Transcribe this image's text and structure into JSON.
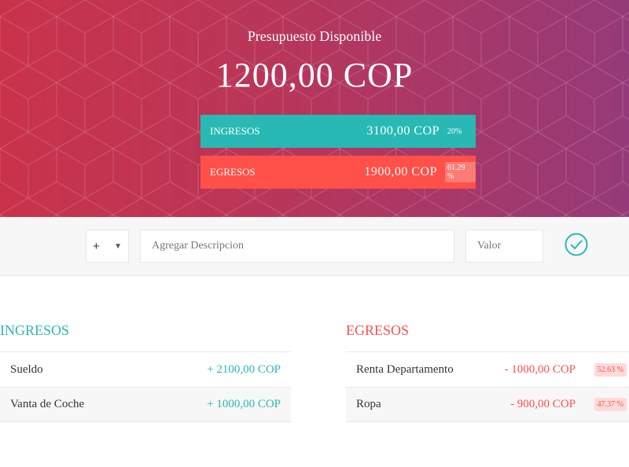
{
  "header": {
    "title": "Presupuesto Disponible",
    "budget": "1200,00 COP"
  },
  "summary": {
    "income": {
      "label": "Ingresos",
      "amount": "3100,00 COP",
      "percent": "20%"
    },
    "expense": {
      "label": "Egresos",
      "amount": "1900,00 COP",
      "percent": "61.29 %"
    }
  },
  "add_form": {
    "type_value": "+",
    "description_placeholder": "Agregar Descripcion",
    "value_placeholder": "Valor"
  },
  "income_list": {
    "title": "Ingresos",
    "items": [
      {
        "description": "Sueldo",
        "value": "+ 2100,00 COP"
      },
      {
        "description": "Vanta de Coche",
        "value": "+ 1000,00 COP"
      }
    ]
  },
  "expense_list": {
    "title": "Egresos",
    "items": [
      {
        "description": "Renta Departamento",
        "value": "- 1000,00 COP",
        "percent": "52.63 %"
      },
      {
        "description": "Ropa",
        "value": "- 900,00 COP",
        "percent": "47.37 %"
      }
    ]
  },
  "colors": {
    "income": "#28b9b5",
    "expense": "#ff5049",
    "header_gradient_start": "#c9334a",
    "header_gradient_end": "#953a78"
  },
  "icons": {
    "add_button": "check-circle-icon",
    "type_select": "chevron-down-icon"
  }
}
